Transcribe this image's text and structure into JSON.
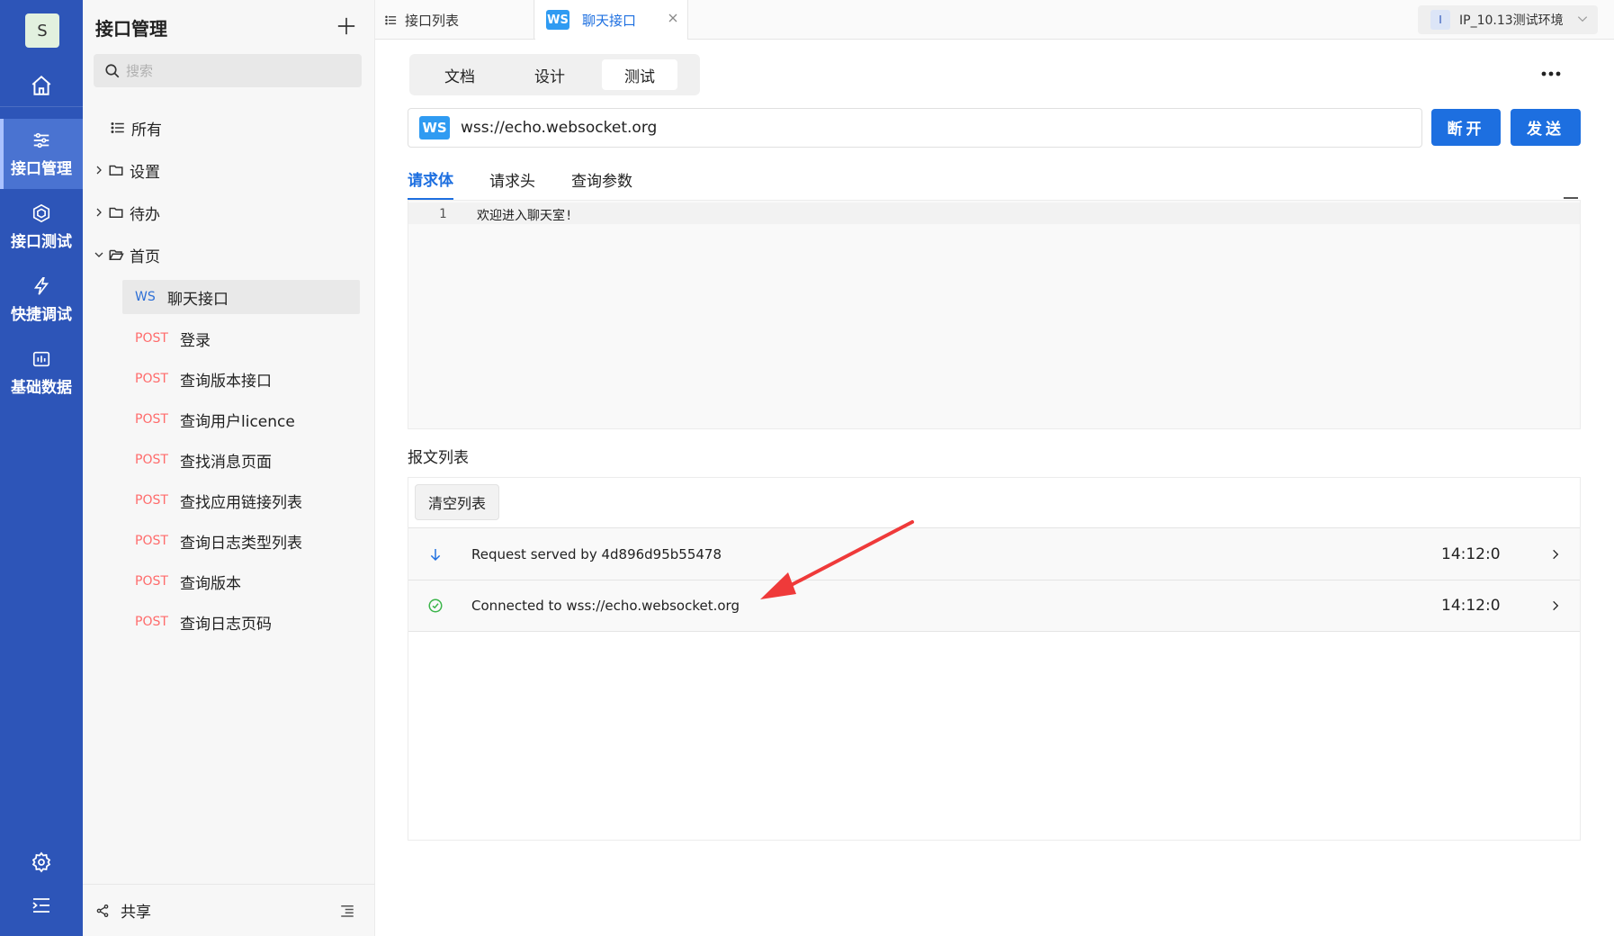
{
  "rail": {
    "avatar": "S",
    "items": [
      {
        "label": "接口管理"
      },
      {
        "label": "接口测试"
      },
      {
        "label": "快捷调试"
      },
      {
        "label": "基础数据"
      }
    ]
  },
  "panel": {
    "title": "接口管理",
    "search_placeholder": "搜索",
    "tree": {
      "all": "所有",
      "settings": "设置",
      "todo": "待办",
      "home": "首页"
    },
    "apis": [
      {
        "method": "WS",
        "name": "聊天接口"
      },
      {
        "method": "POST",
        "name": "登录"
      },
      {
        "method": "POST",
        "name": "查询版本接口"
      },
      {
        "method": "POST",
        "name": "查询用户licence"
      },
      {
        "method": "POST",
        "name": "查找消息页面"
      },
      {
        "method": "POST",
        "name": "查找应用链接列表"
      },
      {
        "method": "POST",
        "name": "查询日志类型列表"
      },
      {
        "method": "POST",
        "name": "查询版本"
      },
      {
        "method": "POST",
        "name": "查询日志页码"
      }
    ],
    "share": "共享"
  },
  "tabs": {
    "list_tab": "接口列表",
    "chat_tab_badge": "WS",
    "chat_tab": "聊天接口",
    "env_icon": "I",
    "env": "IP_10.13测试环境"
  },
  "main": {
    "segments": [
      "文档",
      "设计",
      "测试"
    ],
    "url_badge": "WS",
    "url": "wss://echo.websocket.org",
    "disconnect": "断开",
    "send": "发送",
    "subtabs": [
      "请求体",
      "请求头",
      "查询参数"
    ],
    "editor": {
      "line": "1",
      "text": "欢迎进入聊天室!"
    },
    "log_title": "报文列表",
    "clear": "清空列表",
    "messages": [
      {
        "icon": "arrow-down-icon",
        "text": "Request served by 4d896d95b55478",
        "time": "14:12:0"
      },
      {
        "icon": "check-circle-icon",
        "text": "Connected to wss://echo.websocket.org",
        "time": "14:12:0"
      }
    ]
  },
  "colors": {
    "rail": "#2d55b8",
    "primary": "#1d6fe0",
    "post": "#ff6b6b",
    "ws": "#2f9bf2",
    "success": "#3bb54a",
    "annotation": "#ef3a3a"
  }
}
